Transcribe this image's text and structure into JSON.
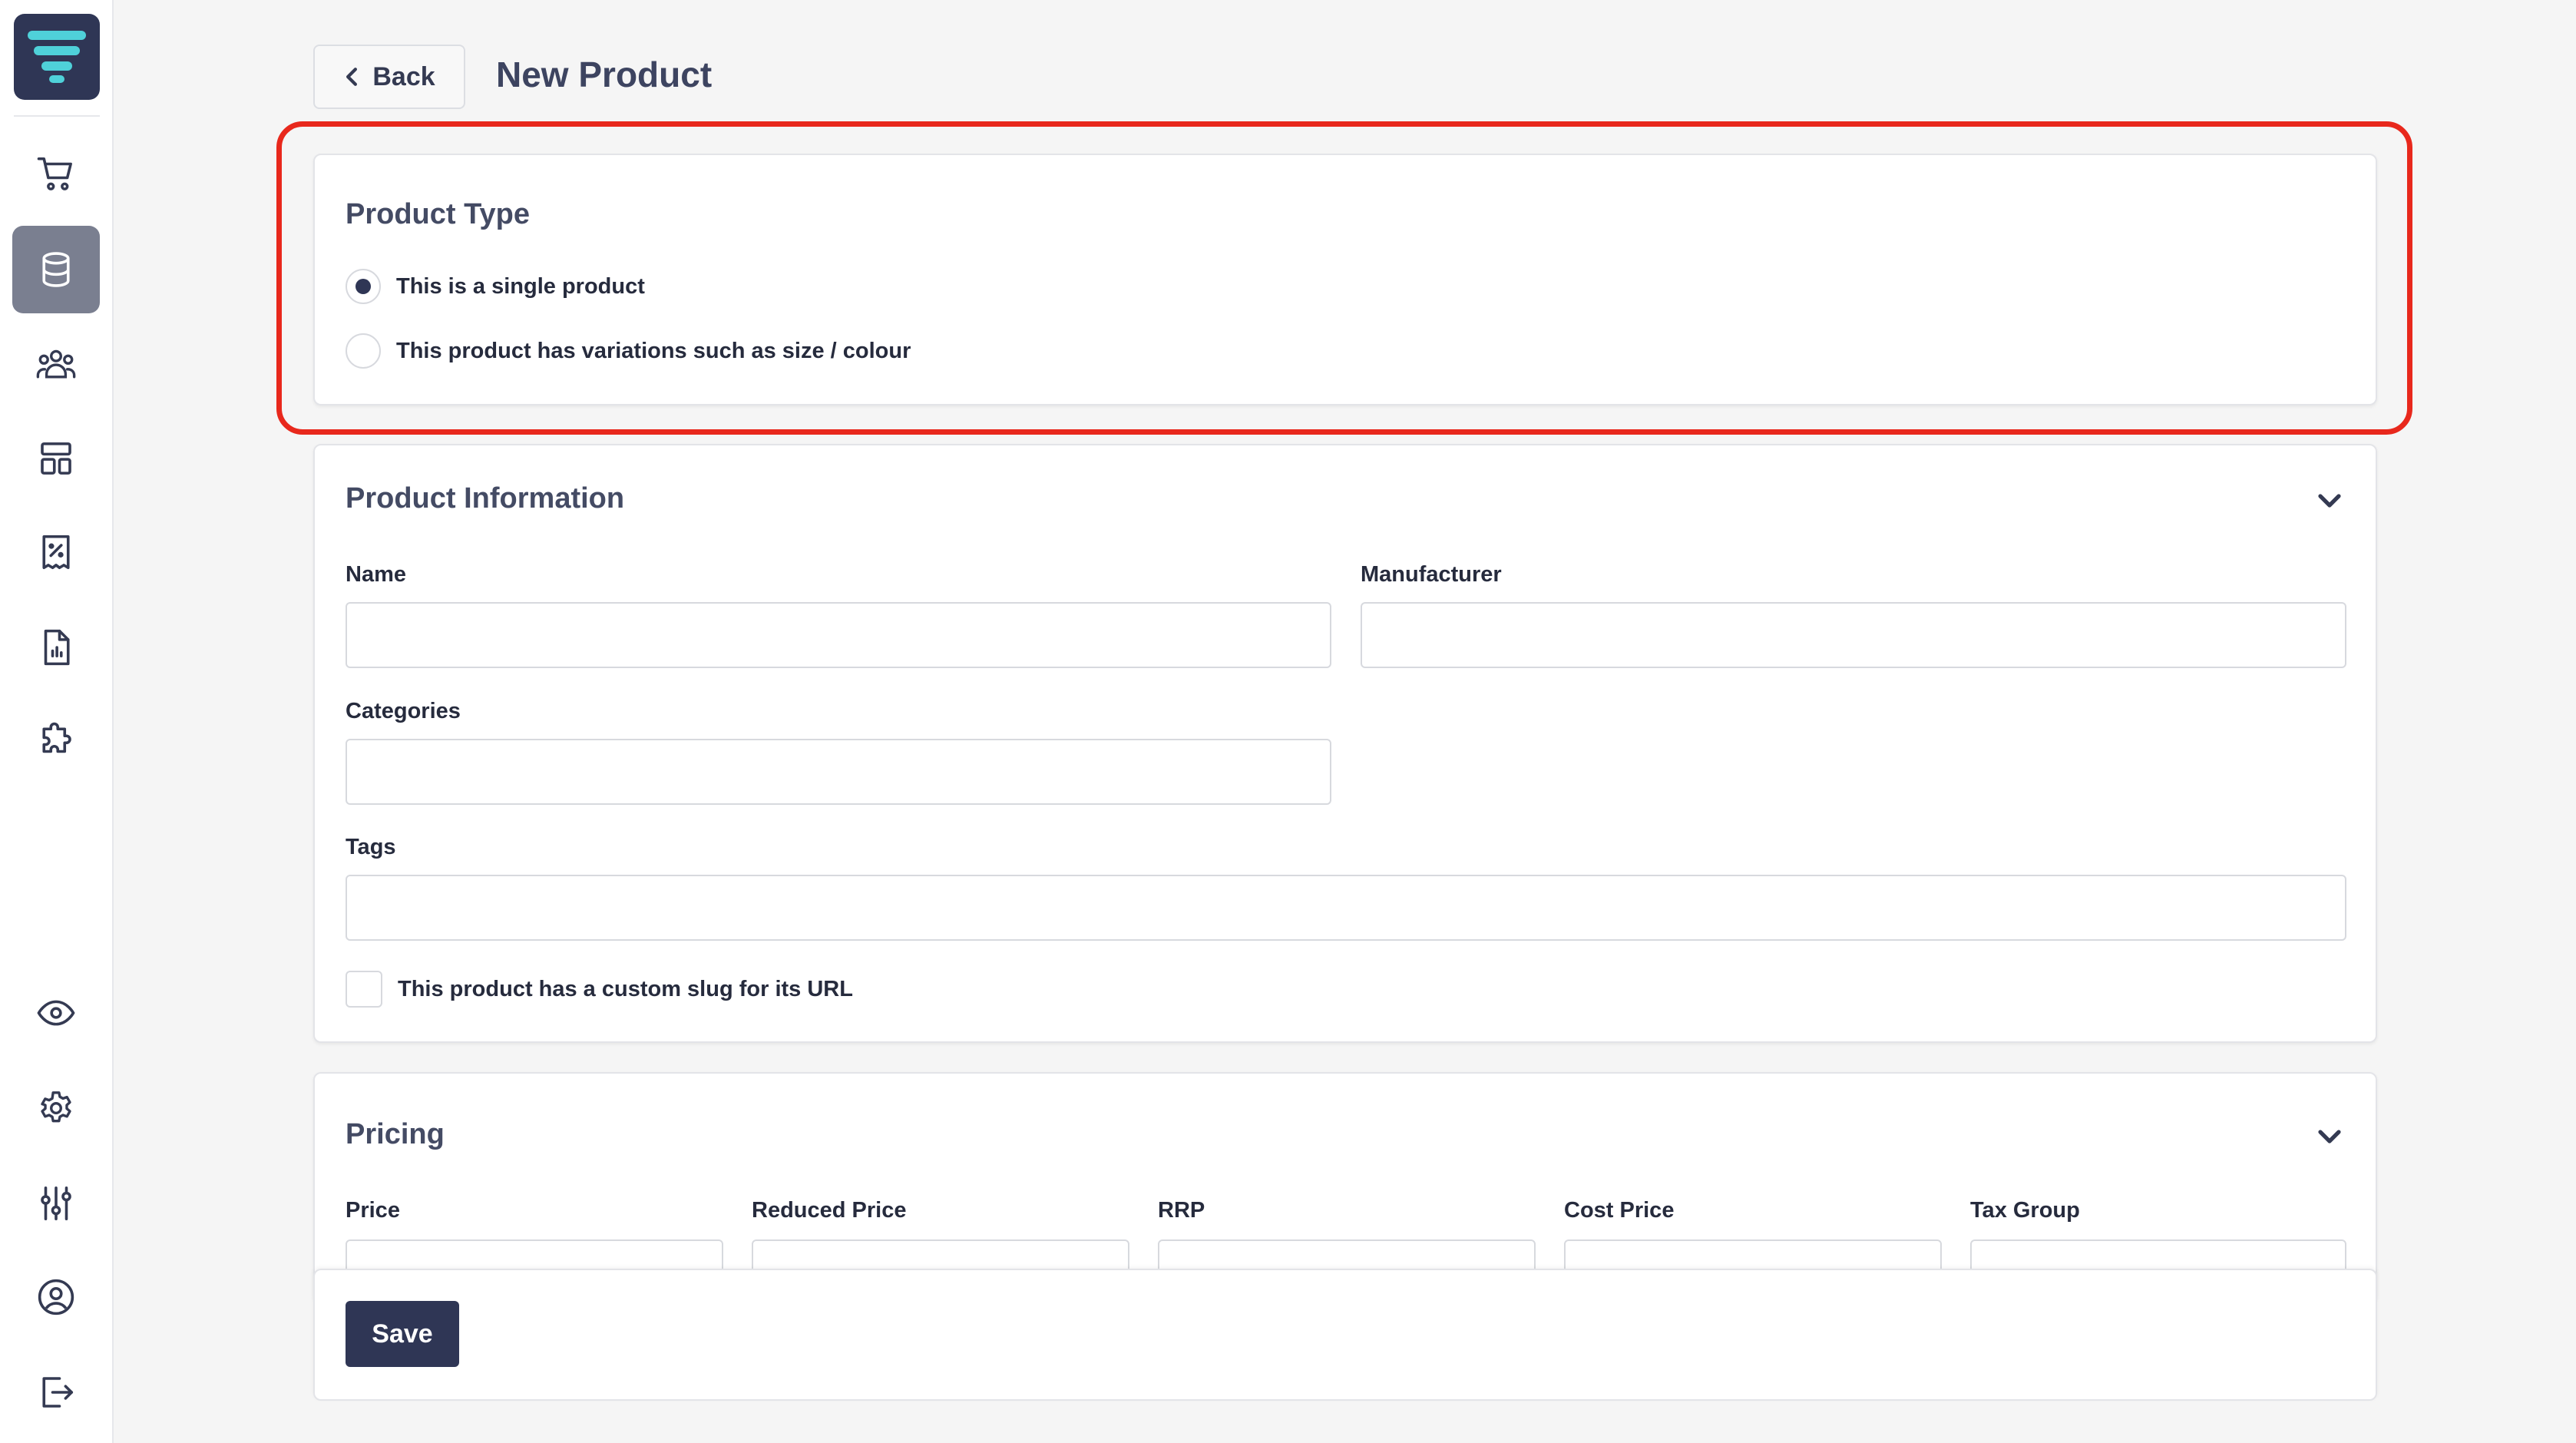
{
  "header": {
    "back_label": "Back",
    "title": "New Product"
  },
  "sidebar": {
    "items": [
      {
        "icon": "cart-icon"
      },
      {
        "icon": "database-icon",
        "active": true
      },
      {
        "icon": "users-icon"
      },
      {
        "icon": "layout-icon"
      },
      {
        "icon": "receipt-percent-icon"
      },
      {
        "icon": "report-icon"
      },
      {
        "icon": "puzzle-icon"
      },
      {
        "icon": "eye-icon"
      },
      {
        "icon": "gear-icon"
      },
      {
        "icon": "sliders-icon"
      },
      {
        "icon": "user-circle-icon"
      },
      {
        "icon": "logout-icon"
      }
    ]
  },
  "product_type": {
    "title": "Product Type",
    "options": [
      {
        "label": "This is a single product",
        "selected": true
      },
      {
        "label": "This product has variations such as size / colour",
        "selected": false
      }
    ]
  },
  "product_info": {
    "title": "Product Information",
    "name_label": "Name",
    "manufacturer_label": "Manufacturer",
    "categories_label": "Categories",
    "tags_label": "Tags",
    "custom_slug_label": "This product has a custom slug for its URL"
  },
  "pricing": {
    "title": "Pricing",
    "columns": [
      "Price",
      "Reduced Price",
      "RRP",
      "Cost Price",
      "Tax Group"
    ]
  },
  "footer": {
    "save_label": "Save"
  },
  "colors": {
    "primary": "#2f3655",
    "highlight": "#e8281c",
    "accent": "#4fd1d9"
  }
}
